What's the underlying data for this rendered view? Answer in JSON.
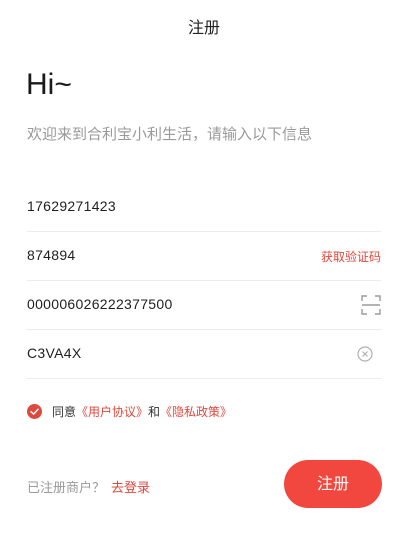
{
  "header": {
    "title": "注册"
  },
  "intro": {
    "greeting": "Hi~",
    "subtitle": "欢迎来到合利宝小利生活，请输入以下信息"
  },
  "form": {
    "phone": {
      "value": "17629271423"
    },
    "sms_code": {
      "value": "874894",
      "action_label": "获取验证码"
    },
    "merchant_no": {
      "value": "000006026222377500",
      "action_icon": "scan-icon"
    },
    "captcha": {
      "value": "C3VA4X",
      "action_icon": "clear-icon"
    }
  },
  "agreement": {
    "checked": true,
    "prefix": "同意",
    "user_agreement": "《用户协议》",
    "conjunction": "和",
    "privacy_policy": "《隐私政策》"
  },
  "footer": {
    "login_hint": "已注册商户？",
    "login_link": "去登录",
    "register_label": "注册"
  },
  "colors": {
    "accent": "#f2473e",
    "link": "#e0483d",
    "muted_text": "#9a9a9a",
    "divider": "#ececec"
  }
}
